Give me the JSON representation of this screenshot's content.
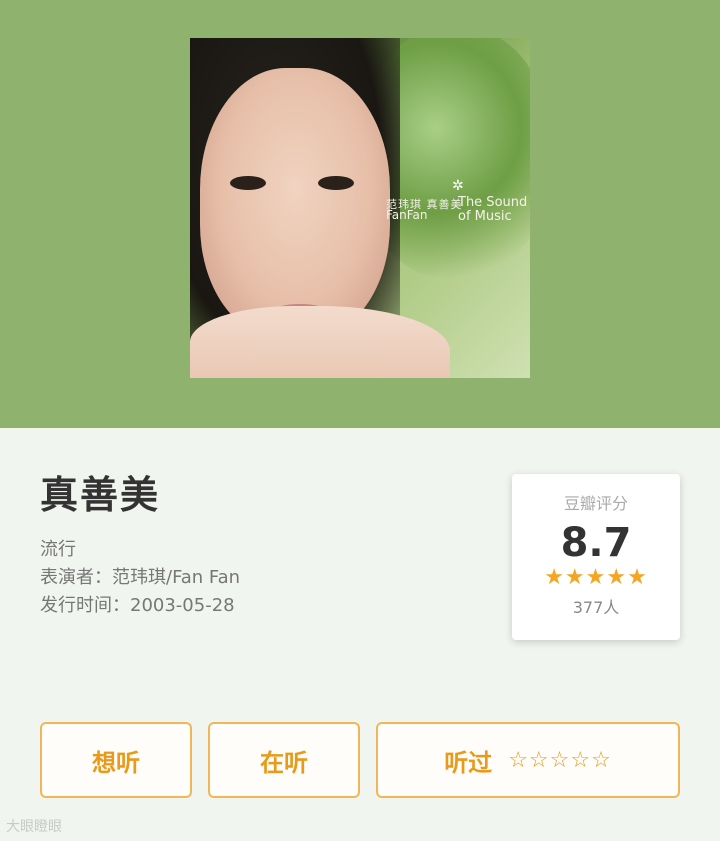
{
  "cover": {
    "title_zh": "范玮琪 真善美",
    "title_en": "FanFan",
    "subtitle": "The Sound of Music",
    "flower_glyph": "✲"
  },
  "album": {
    "title": "真善美",
    "genre": "流行",
    "performer": "表演者：范玮琪/Fan Fan",
    "release": "发行时间：2003-05-28"
  },
  "rating": {
    "label": "豆瓣评分",
    "score": "8.7",
    "stars": 4.5,
    "stars_display": "★★★★★",
    "count": "377人",
    "star_color": "#f4a623"
  },
  "buttons": {
    "want": "想听",
    "doing": "在听",
    "done": "听过",
    "empty_stars": "☆☆☆☆☆"
  },
  "colors": {
    "header_bg": "#8fb36f",
    "page_bg": "#f1f5ef",
    "accent": "#e99a1a"
  },
  "watermark": "大眼瞪眼"
}
